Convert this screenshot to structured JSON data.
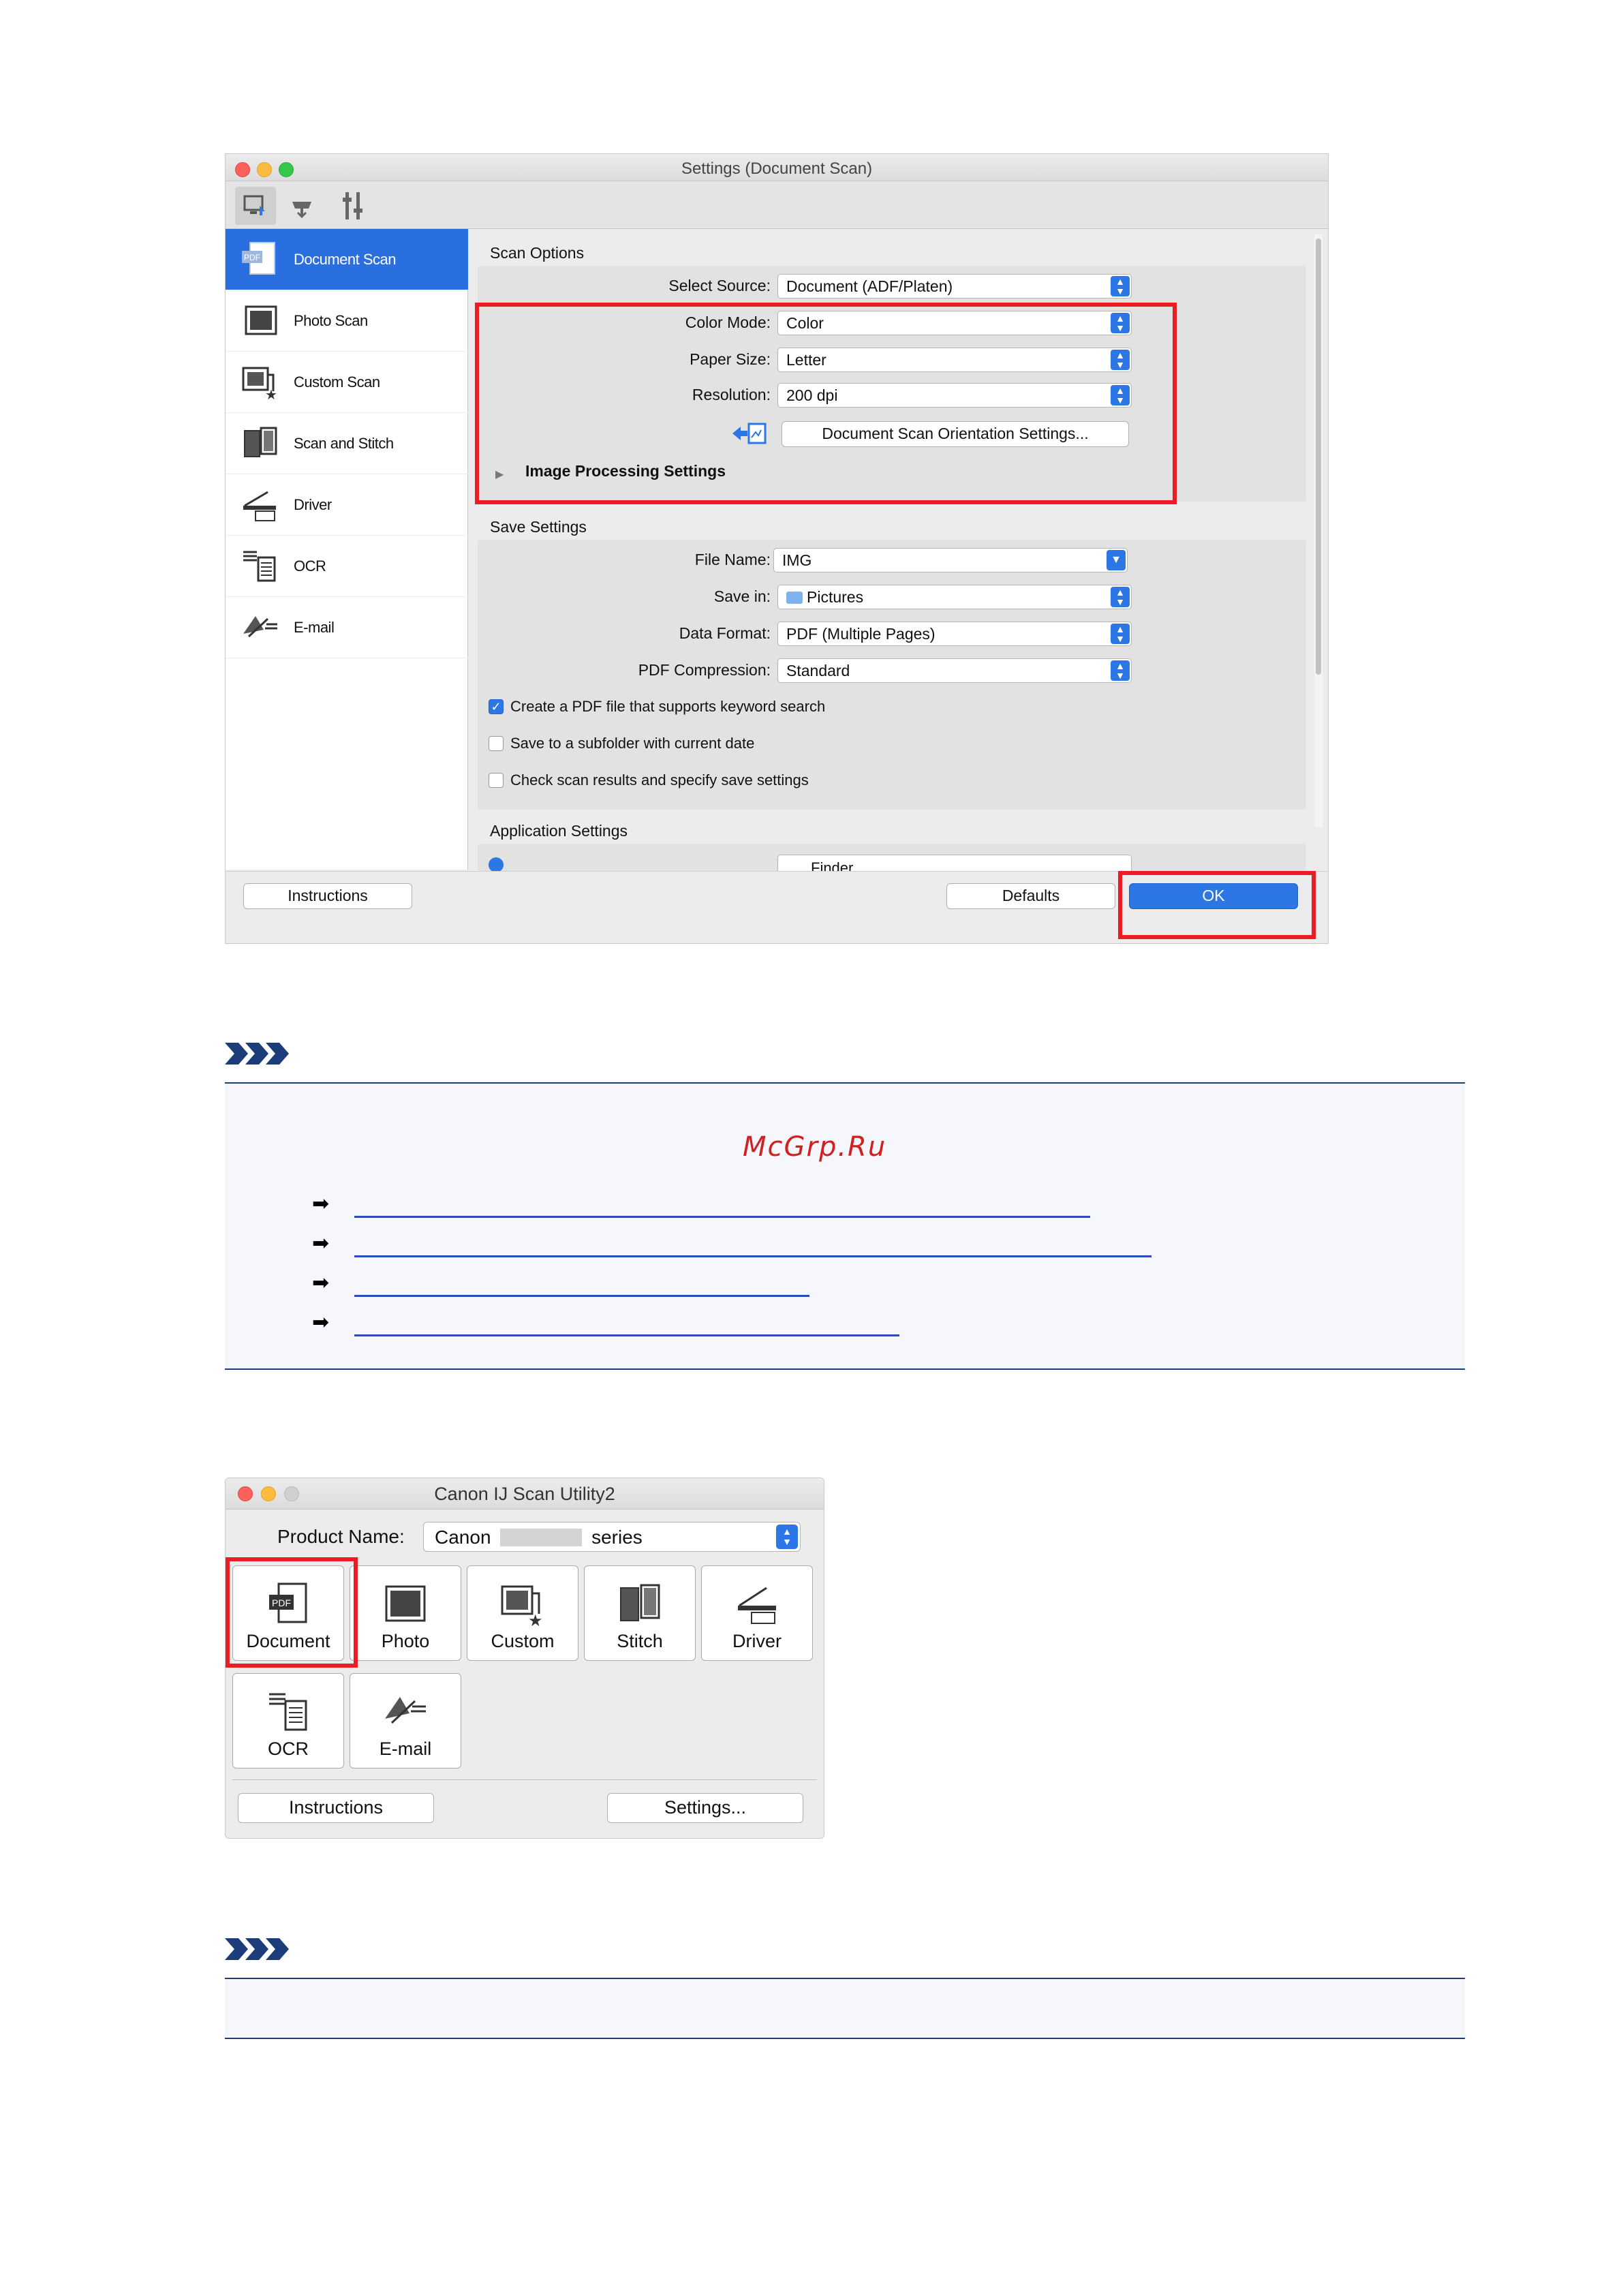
{
  "settings_window": {
    "title": "Settings (Document Scan)",
    "sidebar": [
      {
        "label": "Document Scan",
        "icon": "pdf-document-icon",
        "selected": true
      },
      {
        "label": "Photo Scan",
        "icon": "photo-icon"
      },
      {
        "label": "Custom Scan",
        "icon": "custom-scan-icon"
      },
      {
        "label": "Scan and Stitch",
        "icon": "stitch-icon"
      },
      {
        "label": "Driver",
        "icon": "driver-icon"
      },
      {
        "label": "OCR",
        "icon": "ocr-icon"
      },
      {
        "label": "E-mail",
        "icon": "email-icon"
      }
    ],
    "scan_options": {
      "heading": "Scan Options",
      "select_source_label": "Select Source:",
      "select_source_value": "Document (ADF/Platen)",
      "color_mode_label": "Color Mode:",
      "color_mode_value": "Color",
      "paper_size_label": "Paper Size:",
      "paper_size_value": "Letter",
      "resolution_label": "Resolution:",
      "resolution_value": "200 dpi",
      "orientation_button": "Document Scan Orientation Settings...",
      "image_processing": "Image Processing Settings"
    },
    "save_settings": {
      "heading": "Save Settings",
      "file_name_label": "File Name:",
      "file_name_value": "IMG",
      "save_in_label": "Save in:",
      "save_in_value": "Pictures",
      "data_format_label": "Data Format:",
      "data_format_value": "PDF (Multiple Pages)",
      "pdf_compression_label": "PDF Compression:",
      "pdf_compression_value": "Standard",
      "check1": "Create a PDF file that supports keyword search",
      "check2": "Save to a subfolder with current date",
      "check3": "Check scan results and specify save settings"
    },
    "application_settings": {
      "heading": "Application Settings",
      "partial_value": "Finder"
    },
    "buttons": {
      "instructions": "Instructions",
      "defaults": "Defaults",
      "ok": "OK"
    }
  },
  "note_watermark": "McGrp.Ru",
  "utility_window": {
    "title": "Canon IJ Scan Utility2",
    "product_name_label": "Product Name:",
    "product_name_prefix": "Canon",
    "product_name_suffix": "series",
    "tiles": [
      {
        "label": "Document",
        "icon": "pdf-document-icon"
      },
      {
        "label": "Photo",
        "icon": "photo-icon"
      },
      {
        "label": "Custom",
        "icon": "custom-scan-icon"
      },
      {
        "label": "Stitch",
        "icon": "stitch-icon"
      },
      {
        "label": "Driver",
        "icon": "driver-icon"
      },
      {
        "label": "OCR",
        "icon": "ocr-icon"
      },
      {
        "label": "E-mail",
        "icon": "email-icon"
      }
    ],
    "buttons": {
      "instructions": "Instructions",
      "settings": "Settings..."
    }
  },
  "colors": {
    "highlight_red": "#ec1c24",
    "mac_blue": "#2d76e6",
    "note_rule": "#1c3d7a",
    "link_blue": "#2a4cb8"
  }
}
